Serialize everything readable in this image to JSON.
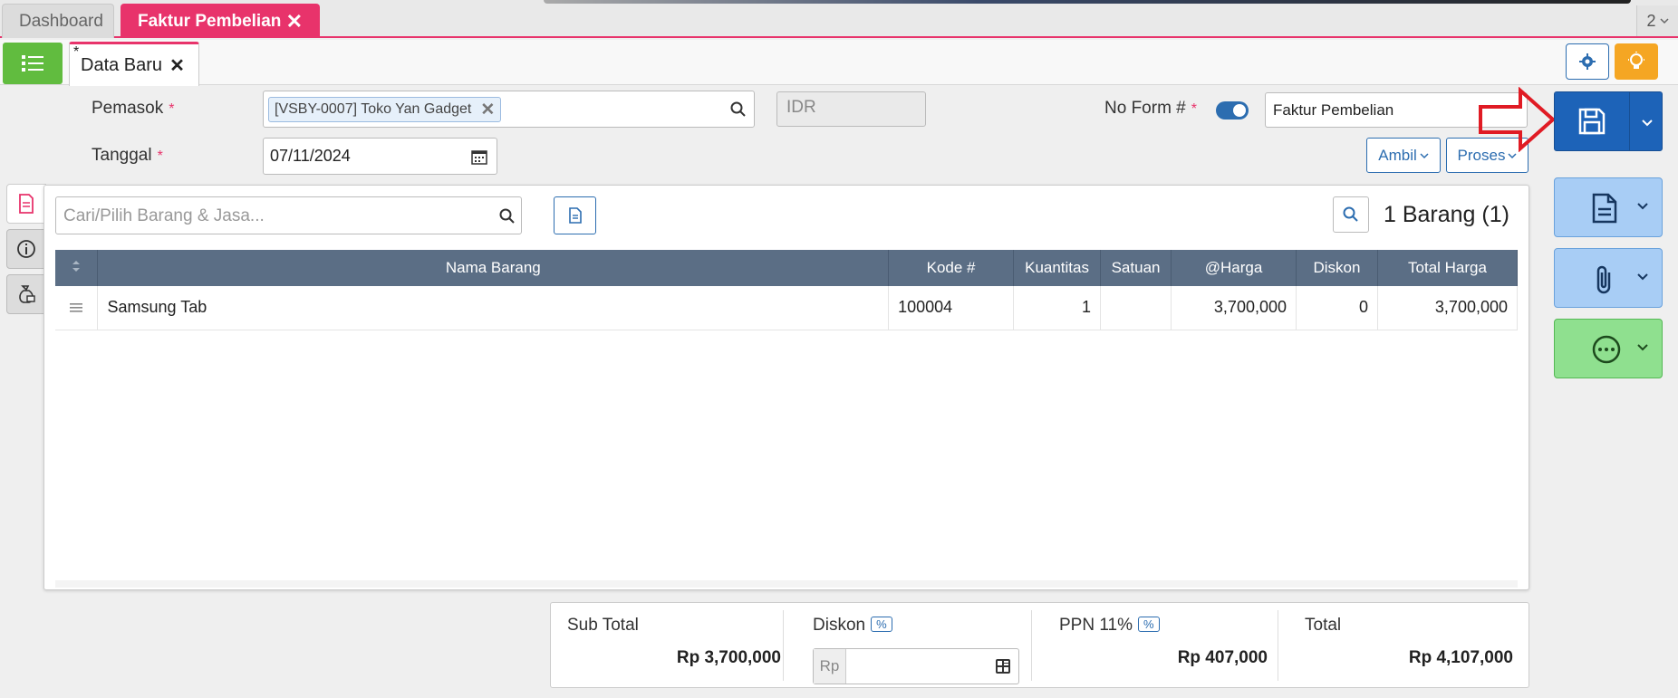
{
  "tabs": {
    "dashboard": "Dashboard",
    "active": "Faktur Pembelian",
    "page_count": "2"
  },
  "subtab": {
    "star": "*",
    "label": "Data Baru"
  },
  "form": {
    "supplier_label": "Pemasok",
    "required_mark": "*",
    "supplier_value": "[VSBY-0007] Toko Yan Gadget",
    "currency": "IDR",
    "date_label": "Tanggal",
    "date_value": "07/11/2024",
    "no_form_label": "No Form #",
    "form_type": "Faktur Pembelian",
    "ambil_label": "Ambil",
    "proses_label": "Proses"
  },
  "items": {
    "search_placeholder": "Cari/Pilih Barang & Jasa...",
    "count_label": "1 Barang (1)",
    "columns": [
      "Nama Barang",
      "Kode #",
      "Kuantitas",
      "Satuan",
      "@Harga",
      "Diskon",
      "Total Harga"
    ],
    "rows": [
      {
        "name": "Samsung Tab",
        "code": "100004",
        "qty": "1",
        "unit": "",
        "price": "3,700,000",
        "discount": "0",
        "total": "3,700,000"
      }
    ]
  },
  "totals": {
    "subtotal_label": "Sub Total",
    "subtotal_value": "Rp 3,700,000",
    "discount_label": "Diskon",
    "pct": "%",
    "rp_prefix": "Rp",
    "ppn_label": "PPN 11%",
    "ppn_value": "Rp 407,000",
    "total_label": "Total",
    "total_value": "Rp 4,107,000"
  },
  "colors": {
    "accent": "#e8336b",
    "primary": "#1d63b8",
    "green": "#61bc3f",
    "header": "#5b6e85"
  }
}
